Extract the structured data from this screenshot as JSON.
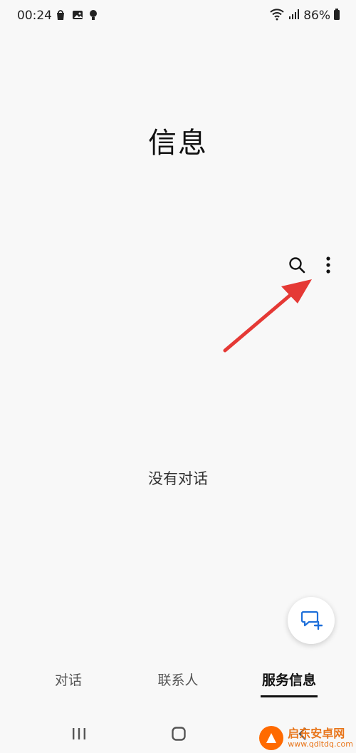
{
  "status_bar": {
    "time": "00:24",
    "battery_percent": "86%",
    "icons_left": [
      "shopping-bag-icon",
      "gallery-icon",
      "bulb-icon"
    ],
    "icons_right": [
      "wifi-icon",
      "signal-icon",
      "battery-icon"
    ]
  },
  "header": {
    "title": "信息"
  },
  "toolbar": {
    "icons": [
      "search-icon",
      "more-vert-icon"
    ]
  },
  "main": {
    "empty_message": "没有对话"
  },
  "fab": {
    "icon": "new-message-icon"
  },
  "tabs": [
    {
      "label": "对话",
      "selected": false
    },
    {
      "label": "联系人",
      "selected": false
    },
    {
      "label": "服务信息",
      "selected": true
    }
  ],
  "nav": {
    "icons": [
      "recents-icon",
      "home-icon",
      "back-icon"
    ]
  },
  "watermark": {
    "title": "启东安卓网",
    "url": "www.qdltdq.com"
  },
  "colors": {
    "background": "#f8f8f8",
    "arrow": "#e53935",
    "watermark": "#e8751a"
  }
}
